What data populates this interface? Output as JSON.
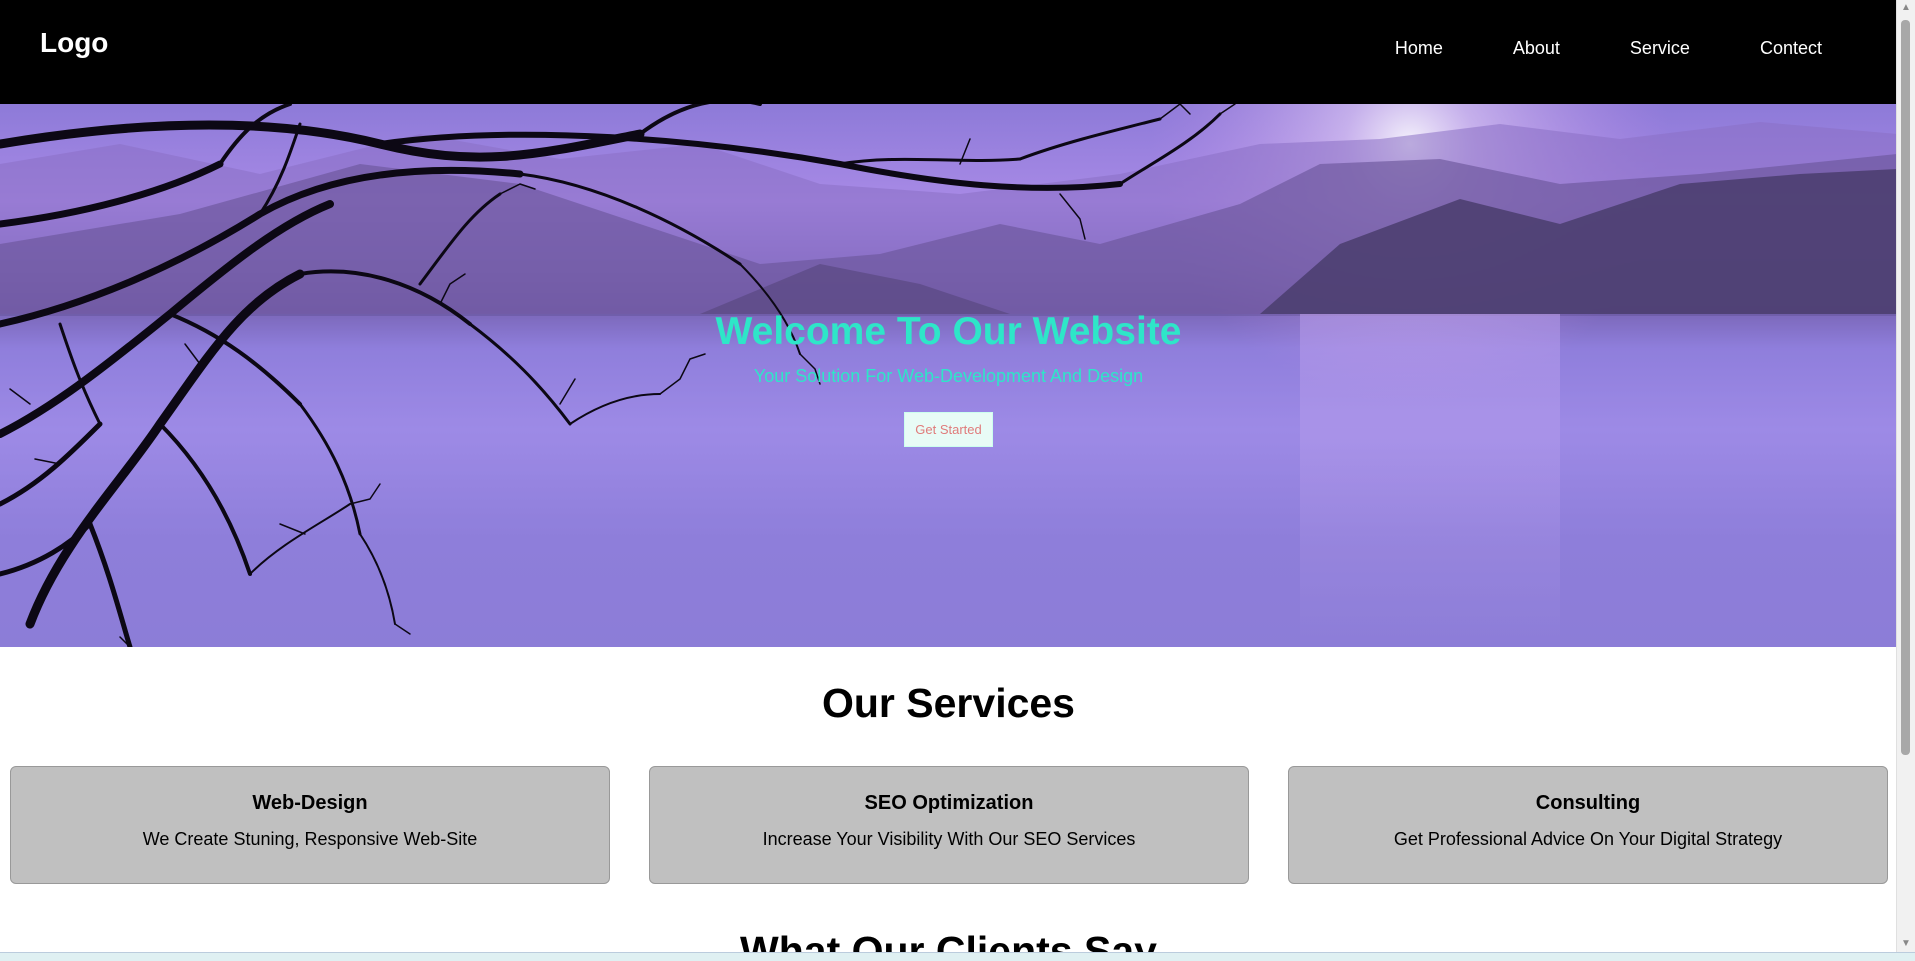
{
  "header": {
    "logo": "Logo",
    "nav": [
      "Home",
      "About",
      "Service",
      "Contect"
    ]
  },
  "hero": {
    "title": "Welcome To Our Website",
    "subtitle": "Your Solution For Web-Development And Design",
    "button": "Get Started"
  },
  "services": {
    "title": "Our Services",
    "cards": [
      {
        "title": "Web-Design",
        "text": "We Create Stuning, Responsive Web-Site"
      },
      {
        "title": "SEO Optimization",
        "text": "Increase Your Visibility With Our SEO Services"
      },
      {
        "title": "Consulting",
        "text": "Get Professional Advice On Your Digital Strategy"
      }
    ]
  },
  "clients": {
    "title": "What Our Clients Say"
  },
  "colors": {
    "header_bg": "#000000",
    "hero_text": "#2ee6c8",
    "card_bg": "#c0c0c0",
    "button_text": "#e07b7b"
  }
}
